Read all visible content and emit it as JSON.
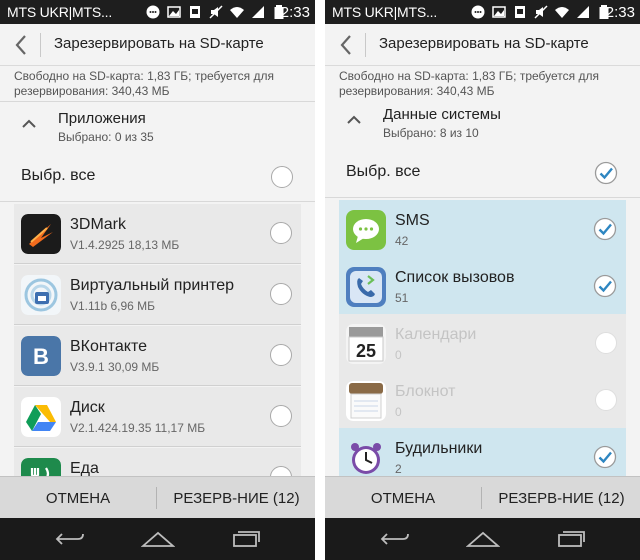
{
  "screens": [
    {
      "status": {
        "carrier": "MTS UKR|MTS...",
        "clock": "2:33"
      },
      "header": {
        "title": "Зарезервировать на SD-карте"
      },
      "storage_info": "Свободно на SD-карта: 1,83 ГБ; требуется для резервирования: 340,43 МБ",
      "section": {
        "title": "Приложения",
        "selected": "Выбрано: 0 из 35"
      },
      "select_all": {
        "label": "Выбр. все",
        "checked": false
      },
      "items": [
        {
          "name": "3DMark",
          "detail": "V1.4.2925 18,13 МБ",
          "icon": "3dmark-icon",
          "checked": false,
          "dimmed": false
        },
        {
          "name": "Виртуальный принтер",
          "detail": "V1.11b 6,96 МБ",
          "icon": "virtual-printer-icon",
          "checked": false,
          "dimmed": false
        },
        {
          "name": "ВКонтакте",
          "detail": "V3.9.1 30,09 МБ",
          "icon": "vkontakte-icon",
          "checked": false,
          "dimmed": false
        },
        {
          "name": "Диск",
          "detail": "V2.1.424.19.35 11,17 МБ",
          "icon": "drive-icon",
          "checked": false,
          "dimmed": false
        },
        {
          "name": "Еда",
          "detail": "",
          "icon": "food-icon",
          "checked": false,
          "dimmed": false
        }
      ],
      "actions": {
        "cancel": "ОТМЕНА",
        "backup": "РЕЗЕРВ-НИЕ (12)"
      }
    },
    {
      "status": {
        "carrier": "MTS UKR|MTS...",
        "clock": "2:33"
      },
      "header": {
        "title": "Зарезервировать на SD-карте"
      },
      "storage_info": "Свободно на SD-карта: 1,83 ГБ; требуется для резервирования: 340,43 МБ",
      "section": {
        "title": "Данные системы",
        "selected": "Выбрано: 8 из 10"
      },
      "select_all": {
        "label": "Выбр. все",
        "checked": true
      },
      "items": [
        {
          "name": "SMS",
          "detail": "42",
          "icon": "sms-icon",
          "checked": true,
          "dimmed": false
        },
        {
          "name": "Список вызовов",
          "detail": "51",
          "icon": "call-log-icon",
          "checked": true,
          "dimmed": false
        },
        {
          "name": "Календари",
          "detail": "0",
          "icon": "calendar-icon",
          "checked": false,
          "dimmed": true
        },
        {
          "name": "Блокнот",
          "detail": "0",
          "icon": "notepad-icon",
          "checked": false,
          "dimmed": true
        },
        {
          "name": "Будильники",
          "detail": "2",
          "icon": "alarm-icon",
          "checked": true,
          "dimmed": false
        }
      ],
      "actions": {
        "cancel": "ОТМЕНА",
        "backup": "РЕЗЕРВ-НИЕ (12)"
      }
    }
  ],
  "colors": {
    "statusbar": "#1e1e1e",
    "background": "#f3f3f3",
    "selected_row": "#cfe6ef",
    "check_accent": "#2e86c1",
    "actionbar": "#d9d9d9",
    "navbar": "#1a1a1a"
  }
}
